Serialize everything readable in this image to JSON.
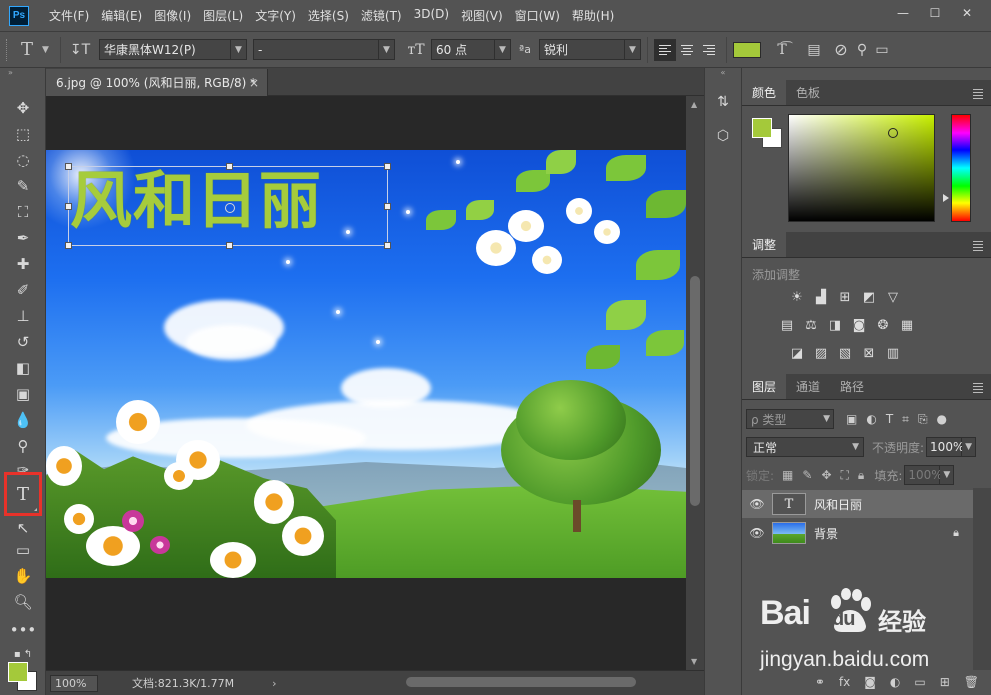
{
  "app": {
    "logo": "Ps",
    "menu": [
      "文件(F)",
      "编辑(E)",
      "图像(I)",
      "图层(L)",
      "文字(Y)",
      "选择(S)",
      "滤镜(T)",
      "3D(D)",
      "视图(V)",
      "窗口(W)",
      "帮助(H)"
    ],
    "window_controls": [
      "—",
      "☐",
      "✕"
    ]
  },
  "options": {
    "font_family": "华康黑体W12(P)",
    "font_style": "-",
    "font_size": "60 点",
    "aa_label": "ªa",
    "antialias": "锐利",
    "text_color": "#a4c93a"
  },
  "document": {
    "tab_title": "6.jpg @ 100% (风和日丽, RGB/8) *",
    "close": "×",
    "headline": "风和日丽",
    "headline_color": "#a6cc3c"
  },
  "status": {
    "zoom": "100%",
    "doc_info": "文档:821.3K/1.77M",
    "arrow": "›"
  },
  "panels": {
    "color": {
      "tabs": [
        "颜色",
        "色板"
      ],
      "foreground": "#a4c93a",
      "background": "#ffffff"
    },
    "adjustments": {
      "tab": "调整",
      "title": "添加调整"
    },
    "layers": {
      "tabs": [
        "图层",
        "通道",
        "路径"
      ],
      "kind_placeholder": "ρ 类型",
      "blend_mode": "正常",
      "opacity_label": "不透明度:",
      "opacity": "100%",
      "lock_label": "锁定:",
      "fill_label": "填充:",
      "fill": "100%",
      "items": [
        {
          "name": "风和日丽",
          "type": "text",
          "thumb": "T",
          "selected": true
        },
        {
          "name": "背景",
          "type": "image",
          "thumb": "",
          "selected": false,
          "locked": true
        }
      ]
    }
  },
  "watermark": {
    "brand": "Bai",
    "brand2": "du",
    "cn": "经验",
    "url": "jingyan.baidu.com"
  }
}
